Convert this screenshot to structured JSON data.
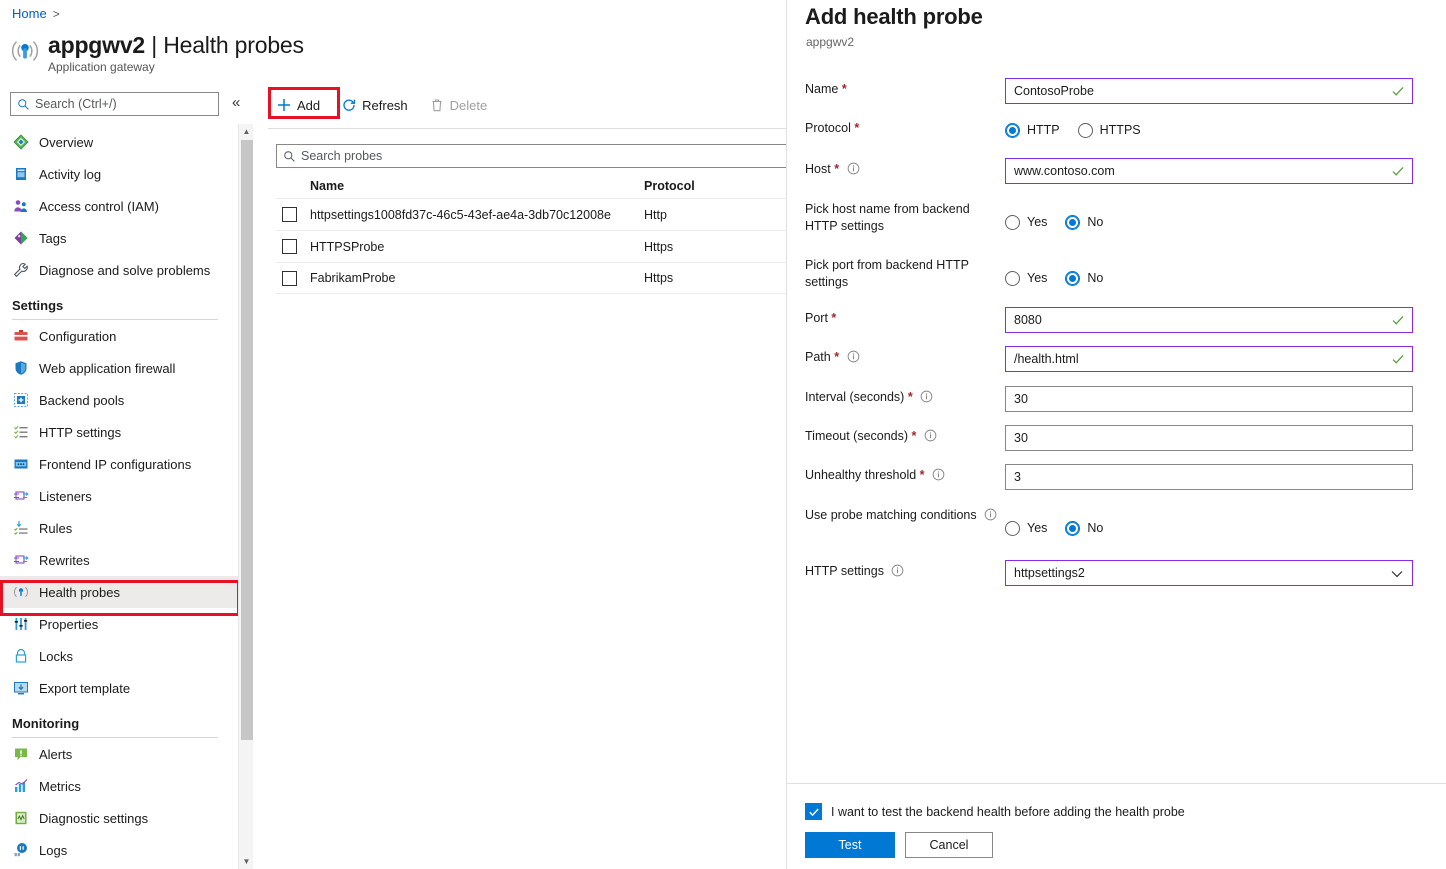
{
  "breadcrumb": {
    "home": "Home",
    "separator": ">"
  },
  "resource": {
    "name": "appgwv2",
    "divider": "|",
    "page": "Health probes",
    "type": "Application gateway",
    "icon": "health-probe-icon"
  },
  "sidebar": {
    "search_placeholder": "Search (Ctrl+/)",
    "collapse_glyph": "«",
    "items": [
      {
        "label": "Overview",
        "icon": "overview-icon"
      },
      {
        "label": "Activity log",
        "icon": "activity-log-icon"
      },
      {
        "label": "Access control (IAM)",
        "icon": "access-control-icon"
      },
      {
        "label": "Tags",
        "icon": "tags-icon"
      },
      {
        "label": "Diagnose and solve problems",
        "icon": "diagnose-icon"
      }
    ],
    "settings_group": {
      "title": "Settings",
      "items": [
        {
          "label": "Configuration",
          "icon": "configuration-icon"
        },
        {
          "label": "Web application firewall",
          "icon": "shield-icon"
        },
        {
          "label": "Backend pools",
          "icon": "backend-pools-icon"
        },
        {
          "label": "HTTP settings",
          "icon": "http-settings-icon"
        },
        {
          "label": "Frontend IP configurations",
          "icon": "frontend-ip-icon"
        },
        {
          "label": "Listeners",
          "icon": "listeners-icon"
        },
        {
          "label": "Rules",
          "icon": "rules-icon"
        },
        {
          "label": "Rewrites",
          "icon": "rewrites-icon"
        },
        {
          "label": "Health probes",
          "icon": "health-probe-icon",
          "selected": true
        },
        {
          "label": "Properties",
          "icon": "properties-icon"
        },
        {
          "label": "Locks",
          "icon": "lock-icon"
        },
        {
          "label": "Export template",
          "icon": "export-template-icon"
        }
      ]
    },
    "monitoring_group": {
      "title": "Monitoring",
      "items": [
        {
          "label": "Alerts",
          "icon": "alerts-icon"
        },
        {
          "label": "Metrics",
          "icon": "metrics-icon"
        },
        {
          "label": "Diagnostic settings",
          "icon": "diagnostic-settings-icon"
        },
        {
          "label": "Logs",
          "icon": "logs-icon"
        }
      ]
    }
  },
  "toolbar": {
    "add_label": "Add",
    "refresh_label": "Refresh",
    "delete_label": "Delete"
  },
  "probes_list": {
    "search_placeholder": "Search probes",
    "columns": [
      "Name",
      "Protocol"
    ],
    "rows": [
      {
        "name": "httpsettings1008fd37c-46c5-43ef-ae4a-3db70c12008e",
        "protocol": "Http"
      },
      {
        "name": "HTTPSProbe",
        "protocol": "Https"
      },
      {
        "name": "FabrikamProbe",
        "protocol": "Https"
      }
    ]
  },
  "panel": {
    "title": "Add health probe",
    "subtitle": "appgwv2",
    "required_mark": "*",
    "fields": {
      "name": {
        "label": "Name",
        "value": "ContosoProbe",
        "valid": true
      },
      "protocol": {
        "label": "Protocol",
        "options": [
          "HTTP",
          "HTTPS"
        ],
        "selected": "HTTP"
      },
      "host": {
        "label": "Host",
        "value": "www.contoso.com",
        "valid": true
      },
      "pick_host": {
        "label": "Pick host name from backend HTTP settings",
        "options": [
          "Yes",
          "No"
        ],
        "selected": "No"
      },
      "pick_port": {
        "label": "Pick port from backend HTTP settings",
        "options": [
          "Yes",
          "No"
        ],
        "selected": "No"
      },
      "port": {
        "label": "Port",
        "value": "8080",
        "valid": true
      },
      "path": {
        "label": "Path",
        "value": "/health.html",
        "valid": true
      },
      "interval": {
        "label": "Interval (seconds)",
        "value": "30",
        "valid": false
      },
      "timeout": {
        "label": "Timeout (seconds)",
        "value": "30",
        "valid": false
      },
      "unhealthy": {
        "label": "Unhealthy threshold",
        "value": "3",
        "valid": false
      },
      "matching": {
        "label": "Use probe matching conditions",
        "options": [
          "Yes",
          "No"
        ],
        "selected": "No"
      },
      "http_settings": {
        "label": "HTTP settings",
        "value": "httpsettings2"
      }
    },
    "footer": {
      "checkbox_label": "I want to test the backend health before adding the health probe",
      "checkbox_checked": true,
      "test_label": "Test",
      "cancel_label": "Cancel"
    }
  },
  "colors": {
    "accent_blue": "#0078d4",
    "highlight_red": "#e81123",
    "valid_border": "#8a2be2",
    "check_green": "#5a9e3d",
    "required_red": "#a4262c"
  }
}
